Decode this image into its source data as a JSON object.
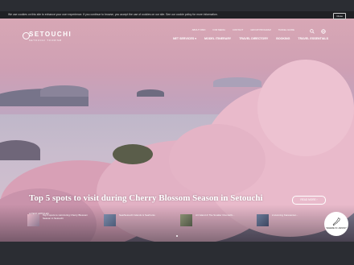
{
  "cookie_bar": {
    "text": "We use cookies on this site to enhance your user experience. If you continue to browse, you accept the use of cookies on our site. See our cookie policy for more information.",
    "close_label": "Close"
  },
  "logo": {
    "title": "SETOUCHI",
    "subtitle": "SETOUCHI TOURISM"
  },
  "top_nav": [
    "ABOUT DMO",
    "FOR MEDIA",
    "CONTACT",
    "GROUP PROGRAM",
    "TRAVEL GUIDE"
  ],
  "main_nav": [
    "NET SERVICES ▾",
    "MODEL ITINERARY",
    "TRAVEL DIRECTORY",
    "BOOKING",
    "TRAVEL ESSENTIALS"
  ],
  "hero": {
    "headline": "Top 5 spots to visit during Cherry Blossom Season in Setouchi",
    "more_label": "READ MORE ›"
  },
  "strip": {
    "label": "LATEST ARTICLES",
    "cards": [
      {
        "title": "Top 5 spots to visit during Cherry Blossom Season in Setouchi"
      },
      {
        "title": "Sea/Setouchi Islands & Seafronts"
      },
      {
        "title": "Art Island & The Smaller Onomichi..."
      },
      {
        "title": "A stunning Karesansui..."
      }
    ]
  },
  "badge": {
    "text": "WHERE IN JAPAN?"
  },
  "icons": [
    "search-icon",
    "globe-icon",
    "japan-map-icon",
    "logo-mark-icon"
  ],
  "colors": {
    "frame": "#2b2d33",
    "blossom": "#e7b7c6",
    "sky": "#d9a8b5"
  }
}
